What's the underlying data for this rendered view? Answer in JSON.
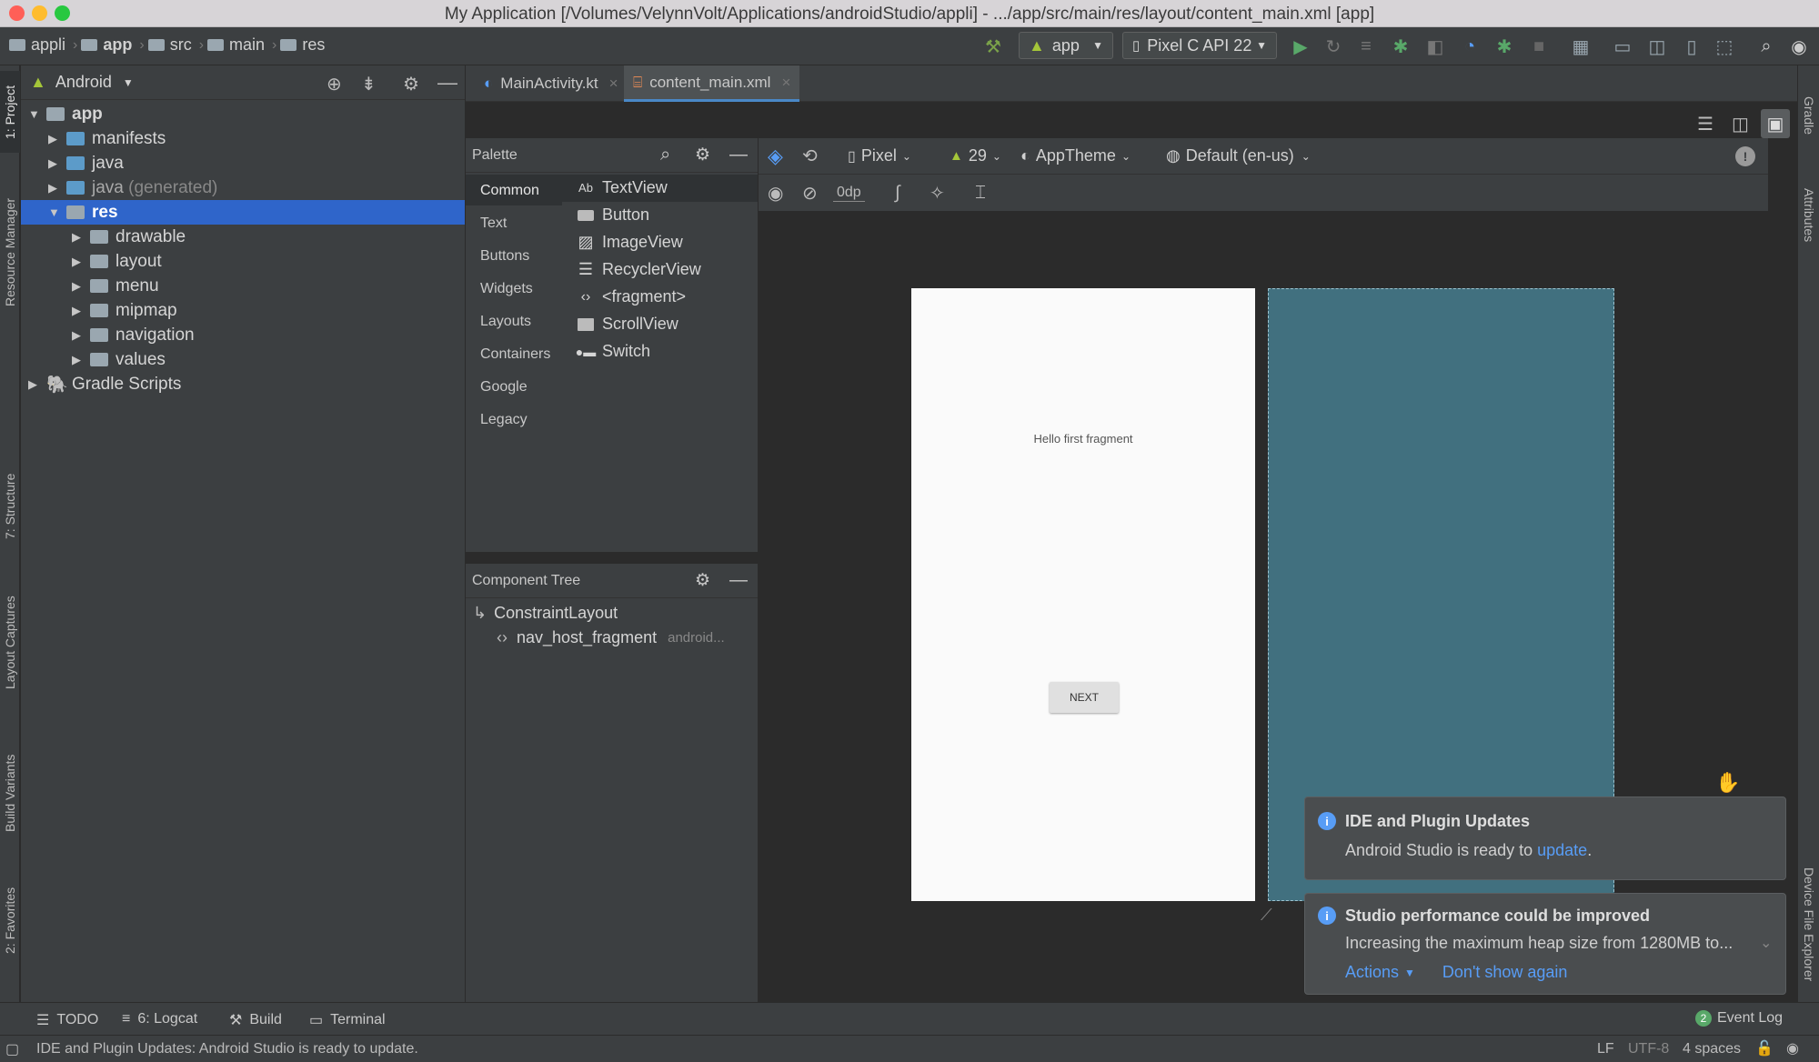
{
  "window": {
    "title": "My Application [/Volumes/VelynnVolt/Applications/androidStudio/appli] - .../app/src/main/res/layout/content_main.xml [app]"
  },
  "breadcrumb": [
    "appli",
    "app",
    "src",
    "main",
    "res"
  ],
  "toolbar": {
    "run_config": "app",
    "device": "Pixel C API 22"
  },
  "project": {
    "view_mode": "Android",
    "tree": [
      {
        "label": "app",
        "suffix": ""
      },
      {
        "label": "manifests",
        "suffix": ""
      },
      {
        "label": "java",
        "suffix": ""
      },
      {
        "label": "java",
        "suffix": "(generated)"
      },
      {
        "label": "res",
        "suffix": ""
      },
      {
        "label": "drawable",
        "suffix": ""
      },
      {
        "label": "layout",
        "suffix": ""
      },
      {
        "label": "menu",
        "suffix": ""
      },
      {
        "label": "mipmap",
        "suffix": ""
      },
      {
        "label": "navigation",
        "suffix": ""
      },
      {
        "label": "values",
        "suffix": ""
      },
      {
        "label": "Gradle Scripts",
        "suffix": ""
      }
    ]
  },
  "left_stripe": [
    "1: Project",
    "Resource Manager",
    "7: Structure",
    "Layout Captures",
    "Build Variants",
    "2: Favorites"
  ],
  "right_stripe": [
    "Gradle",
    "Attributes",
    "Device File Explorer"
  ],
  "editor_tabs": [
    {
      "label": "MainActivity.kt"
    },
    {
      "label": "content_main.xml"
    }
  ],
  "design_toolbar": {
    "device": "Pixel",
    "api": "29",
    "theme": "AppTheme",
    "locale": "Default (en-us)",
    "margin": "0dp"
  },
  "palette": {
    "title": "Palette",
    "categories": [
      "Common",
      "Text",
      "Buttons",
      "Widgets",
      "Layouts",
      "Containers",
      "Google",
      "Legacy"
    ],
    "items": [
      "TextView",
      "Button",
      "ImageView",
      "RecyclerView",
      "<fragment>",
      "ScrollView",
      "Switch"
    ],
    "textview_icon": "Ab"
  },
  "component_tree": {
    "title": "Component Tree",
    "root": "ConstraintLayout",
    "child": "nav_host_fragment",
    "child_hint": "android..."
  },
  "preview": {
    "text": "Hello first fragment",
    "button": "NEXT",
    "blueprint_color": "#41707f"
  },
  "notifications": [
    {
      "title": "IDE and Plugin Updates",
      "body": "Android Studio is ready to",
      "link": "update",
      "after": "."
    },
    {
      "title": "Studio performance could be improved",
      "body": "Increasing the maximum heap size from 1280MB to...",
      "actions": "Actions",
      "dismiss": "Don't show again"
    }
  ],
  "bottom_tabs": [
    {
      "label": "TODO"
    },
    {
      "label": "6: Logcat"
    },
    {
      "label": "Build"
    },
    {
      "label": "Terminal"
    }
  ],
  "event_log": {
    "count": "2",
    "label": "Event Log"
  },
  "status": {
    "message": "IDE and Plugin Updates: Android Studio is ready to update.",
    "line_sep": "LF",
    "encoding": "UTF-8",
    "indent": "4 spaces"
  }
}
